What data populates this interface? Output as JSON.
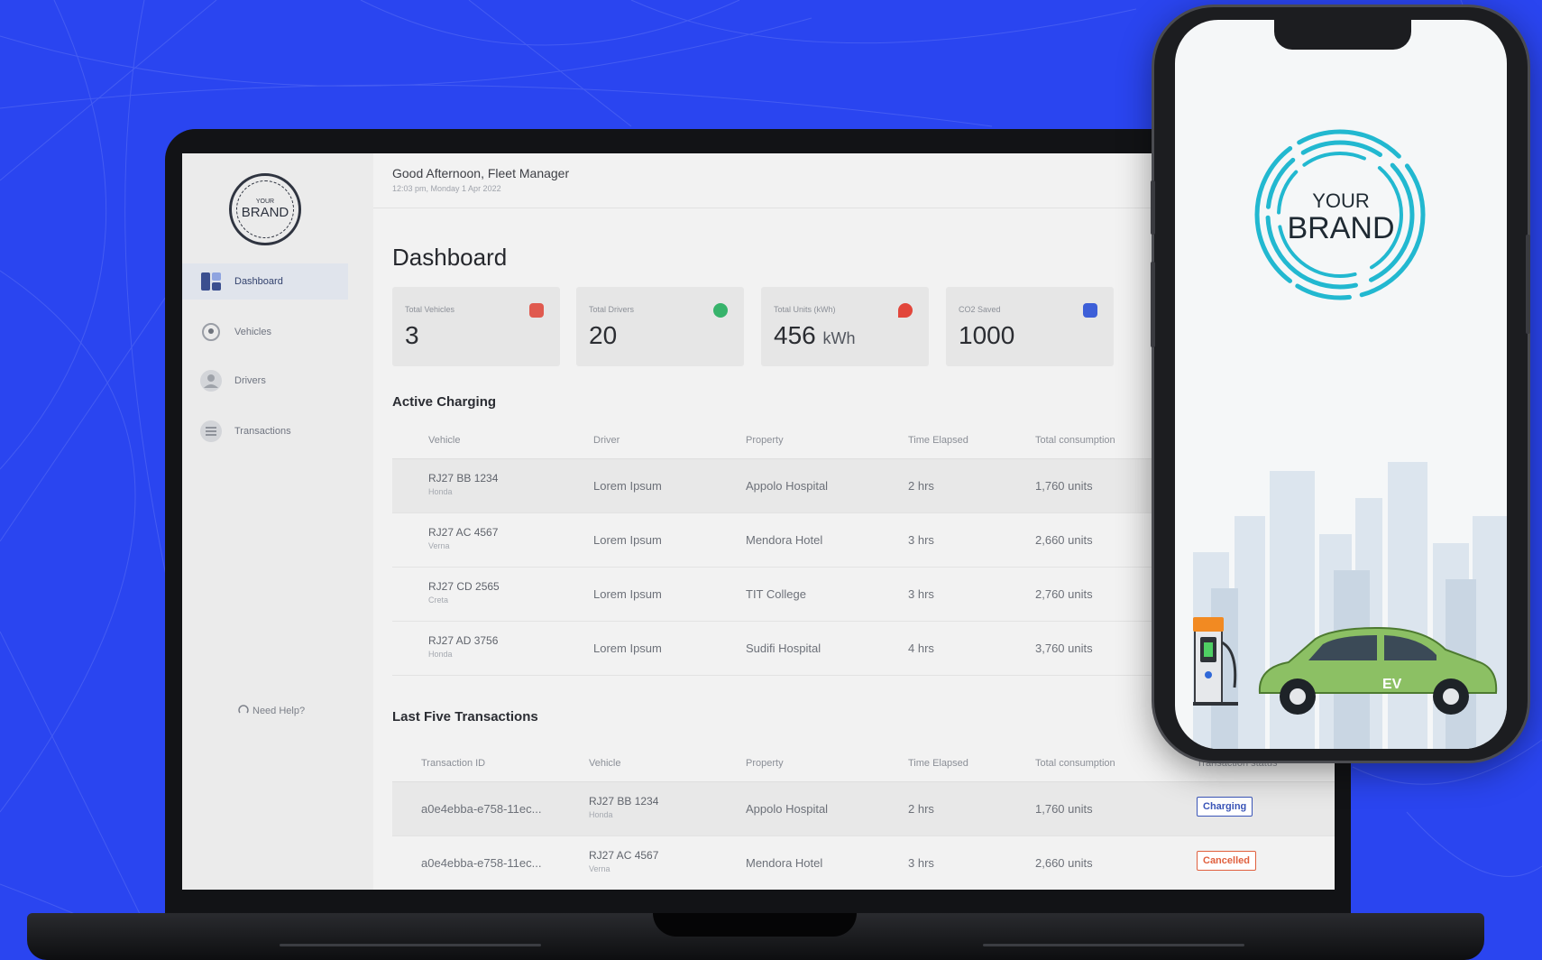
{
  "sidebar": {
    "logo_small": "YOUR",
    "logo_big": "BRAND",
    "items": [
      {
        "label": "Dashboard",
        "icon": "dashboard-icon"
      },
      {
        "label": "Vehicles",
        "icon": "location-pin-icon"
      },
      {
        "label": "Drivers",
        "icon": "user-icon"
      },
      {
        "label": "Transactions",
        "icon": "list-icon"
      }
    ],
    "help": "Need Help?"
  },
  "header": {
    "greeting": "Good Afternoon, Fleet Manager",
    "datetime": "12:03 pm, Monday 1 Apr 2022"
  },
  "page": {
    "title": "Dashboard"
  },
  "cards": [
    {
      "label": "Total Vehicles",
      "value": "3",
      "unit": "",
      "icon": "car-icon",
      "color": "#e05a4f"
    },
    {
      "label": "Total Drivers",
      "value": "20",
      "unit": "",
      "icon": "users-icon",
      "color": "#37b36b"
    },
    {
      "label": "Total Units (kWh)",
      "value": "456",
      "unit": "kWh",
      "icon": "location-icon",
      "color": "#e2463b"
    },
    {
      "label": "CO2 Saved",
      "value": "1000",
      "unit": "",
      "icon": "leaf-icon",
      "color": "#3d5fd8"
    }
  ],
  "active_charging": {
    "title": "Active Charging",
    "columns": [
      "Vehicle",
      "Driver",
      "Property",
      "Time Elapsed",
      "Total consumption"
    ],
    "rows": [
      {
        "vehicle": "RJ27 BB 1234",
        "model": "Honda",
        "driver": "Lorem Ipsum",
        "property": "Appolo Hospital",
        "time": "2 hrs",
        "consumption": "1,760 units"
      },
      {
        "vehicle": "RJ27 AC 4567",
        "model": "Verna",
        "driver": "Lorem Ipsum",
        "property": "Mendora Hotel",
        "time": "3 hrs",
        "consumption": "2,660 units"
      },
      {
        "vehicle": "RJ27 CD 2565",
        "model": "Creta",
        "driver": "Lorem Ipsum",
        "property": "TIT College",
        "time": "3 hrs",
        "consumption": "2,760 units"
      },
      {
        "vehicle": "RJ27 AD 3756",
        "model": "Honda",
        "driver": "Lorem Ipsum",
        "property": "Sudifi Hospital",
        "time": "4 hrs",
        "consumption": "3,760 units"
      }
    ]
  },
  "transactions": {
    "title": "Last Five Transactions",
    "columns": [
      "Transaction ID",
      "Vehicle",
      "Property",
      "Time Elapsed",
      "Total consumption",
      "Transaction status"
    ],
    "rows": [
      {
        "id": "a0e4ebba-e758-11ec...",
        "vehicle": "RJ27 BB 1234",
        "model": "Honda",
        "property": "Appolo Hospital",
        "time": "2 hrs",
        "consumption": "1,760 units",
        "status": "Charging"
      },
      {
        "id": "a0e4ebba-e758-11ec...",
        "vehicle": "RJ27 AC 4567",
        "model": "Verna",
        "property": "Mendora Hotel",
        "time": "3 hrs",
        "consumption": "2,660 units",
        "status": "Cancelled"
      }
    ]
  },
  "phone": {
    "brand_your": "YOUR",
    "brand_brand": "BRAND",
    "car_label": "EV",
    "ring_color": "#22b8d0",
    "car_color": "#8cc064"
  },
  "colors": {
    "background": "#2a45f0",
    "accent": "#3a55b8",
    "cancelled": "#e0603e"
  }
}
